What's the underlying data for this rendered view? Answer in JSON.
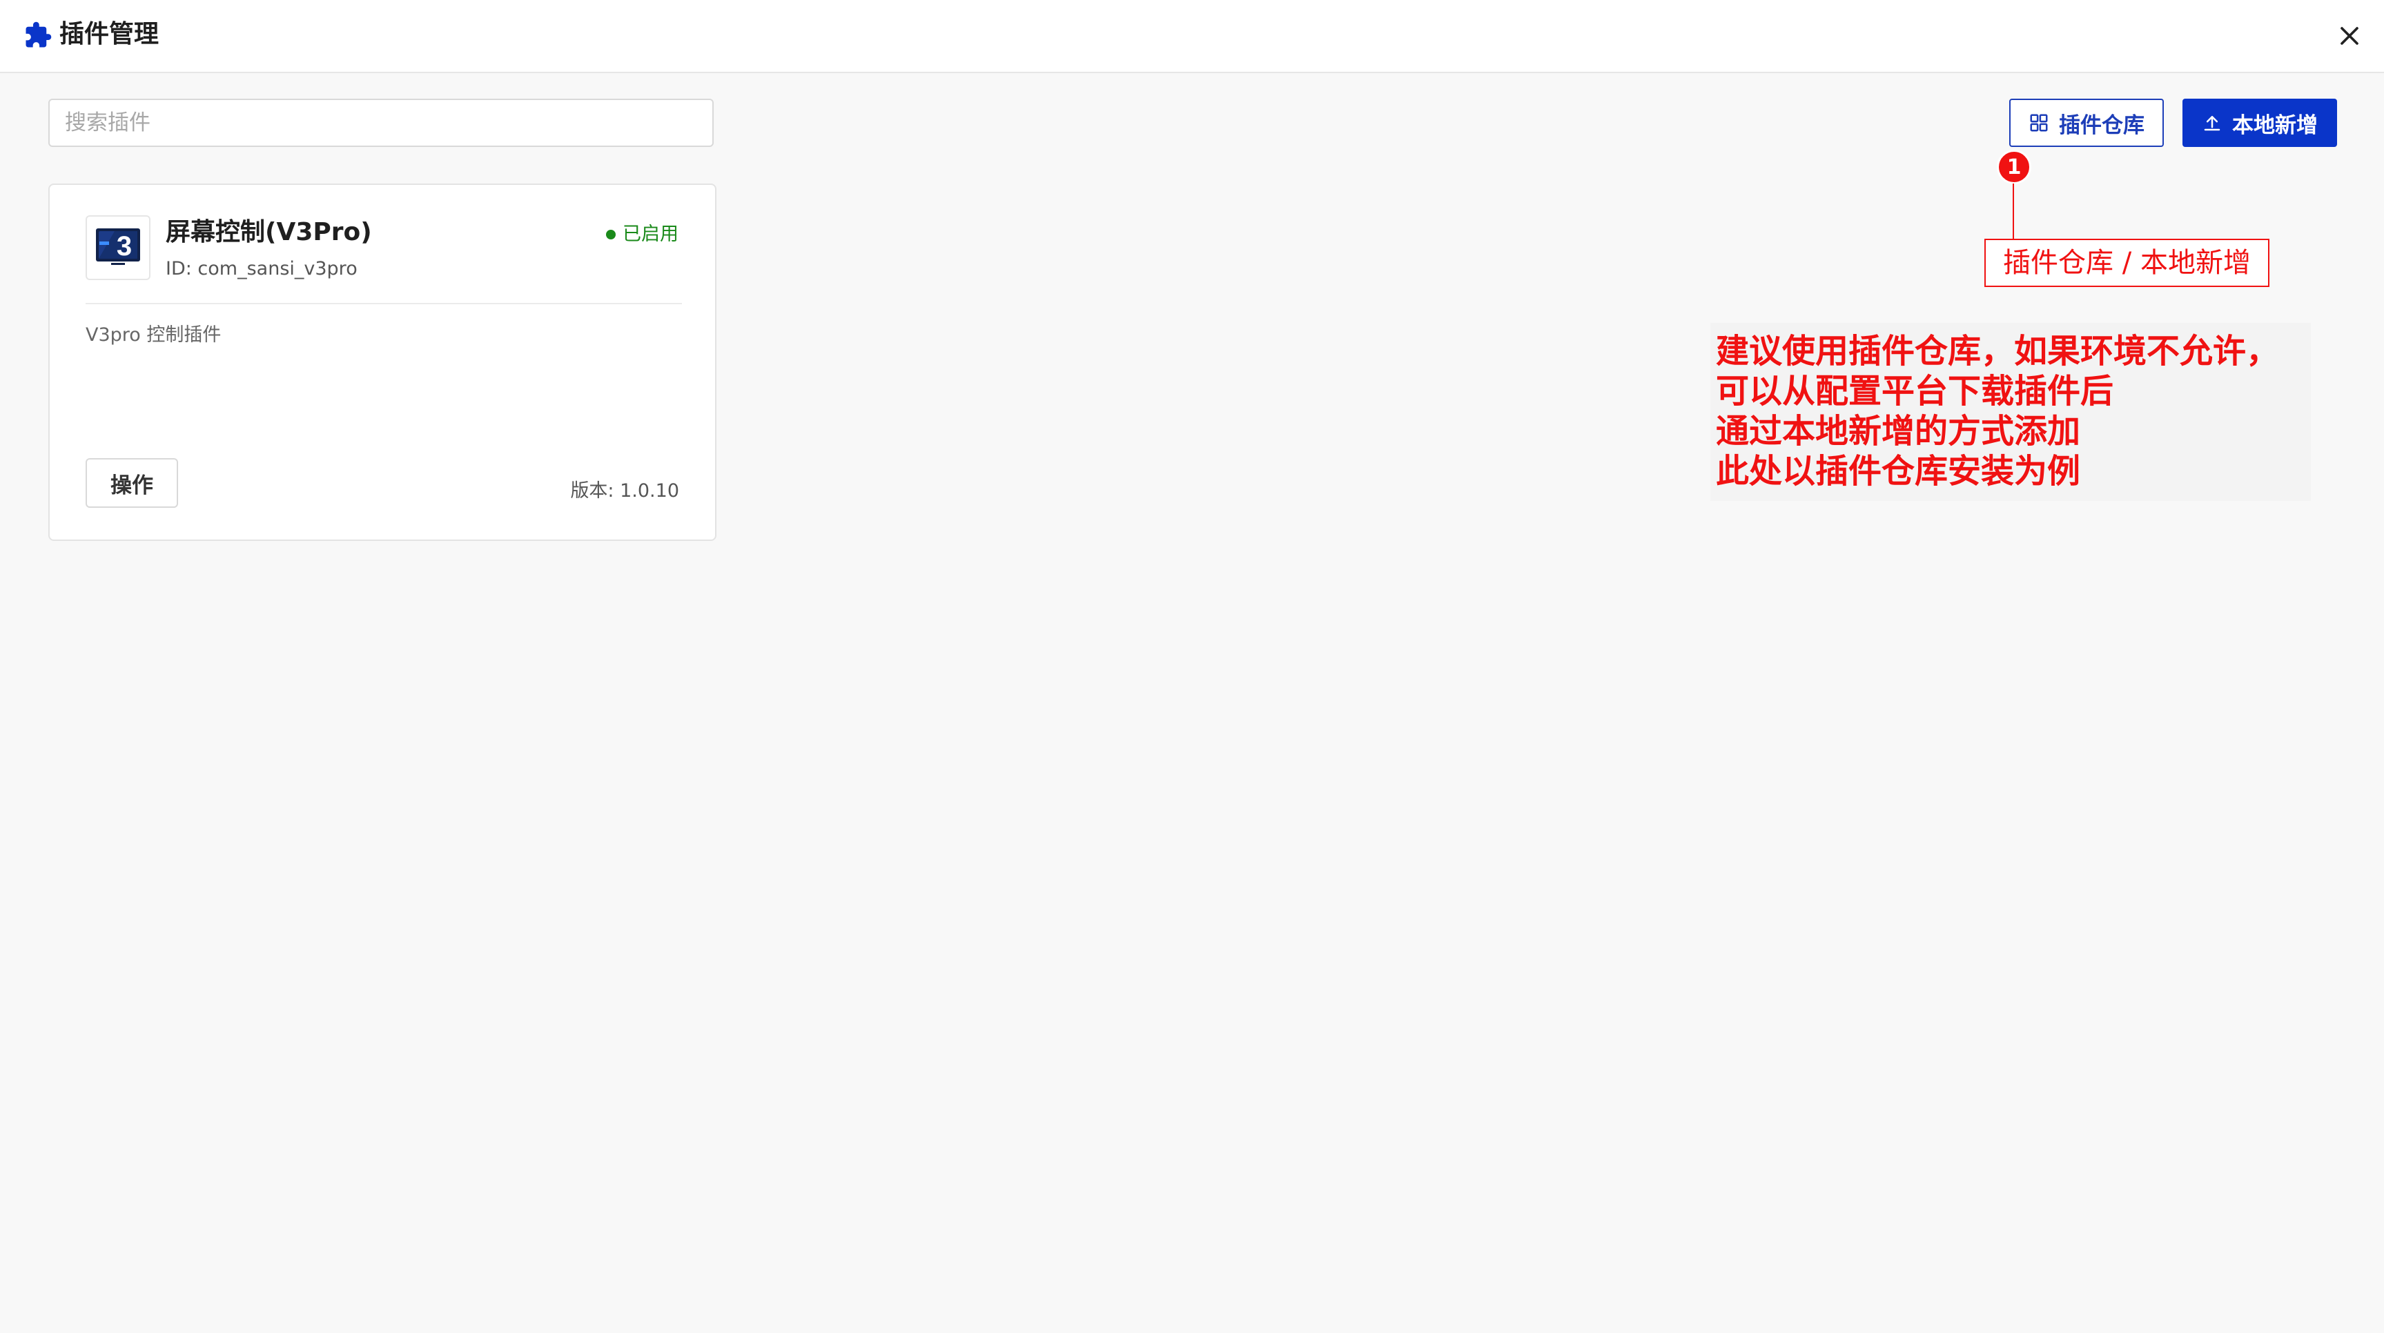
{
  "header": {
    "title": "插件管理",
    "icon": "puzzle-icon",
    "close_icon": "close-icon"
  },
  "search": {
    "placeholder": "搜索插件",
    "value": ""
  },
  "toolbar": {
    "repo_label": "插件仓库",
    "repo_icon": "grid-icon",
    "local_label": "本地新增",
    "local_icon": "upload-icon"
  },
  "plugins": [
    {
      "name": "屏幕控制(V3Pro)",
      "id_label": "ID: com_sansi_v3pro",
      "status": "已启用",
      "description": "V3pro 控制插件",
      "action_label": "操作",
      "version_label": "版本: 1.0.10",
      "logo_text": "3"
    }
  ],
  "annotation": {
    "badge_number": "1",
    "label": "插件仓库 / 本地新增",
    "note_lines": [
      "建议使用插件仓库，如果环境不允许，",
      "可以从配置平台下载插件后",
      "通过本地新增的方式添加",
      "此处以插件仓库安装为例"
    ]
  },
  "colors": {
    "primary": "#0a35c9",
    "primary_border": "#1d3eb8",
    "status_green": "#1a8a1a",
    "annotation_red": "#f01212",
    "background": "#f8f8f8"
  }
}
